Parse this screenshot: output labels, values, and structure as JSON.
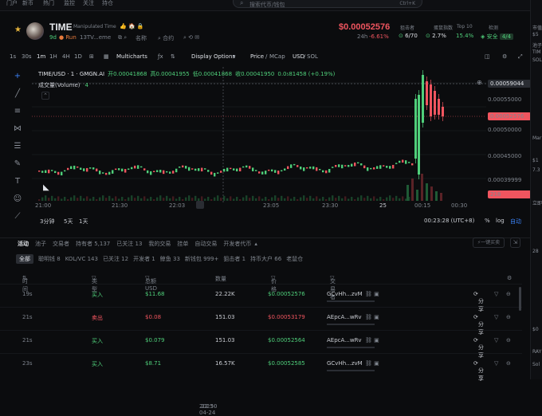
{
  "nav": {
    "items": [
      "门户",
      "新币",
      "热门",
      "监控",
      "关注",
      "持仓"
    ]
  },
  "search": {
    "placeholder": "搜索代币/钱包",
    "shortcut": "Ctrl+K"
  },
  "token": {
    "name": "TIME",
    "fullname": "Manipulated Time",
    "age": "9d",
    "run": "Run",
    "ca": "13TV...eme",
    "name_label": "名称",
    "contract_label": "合约",
    "price": "$0.00052576",
    "change_24h_label": "24h",
    "change_24h": "-6.61%",
    "snipers_label": "狙击者",
    "snipers": "6/70",
    "rat_label": "蛋鼠指数",
    "rat": "2.7%",
    "top10_label": "Top 10",
    "top10": "15.4%",
    "audit_label": "检测",
    "audit_safe": "安全",
    "audit_count": "4/4"
  },
  "toolbar": {
    "intervals": [
      "1s",
      "30s",
      "1m",
      "1H",
      "4H",
      "1D"
    ],
    "multicharts": "Multicharts",
    "display": "Display Options",
    "price": "Price",
    "mcap": "MCap",
    "usd": "USD",
    "sol": "SOL"
  },
  "ohlc": {
    "symbol": "TIME/USD · 1 · GMGN.AI",
    "open_label": "开",
    "open": "0.00041868",
    "high_label": "高",
    "high": "0.00041955",
    "low_label": "低",
    "low": "0.00041868",
    "close_label": "收",
    "close": "0.00041950",
    "delta": "0.0₅81458 (+0.19%)",
    "volume_label": "成交量(Volume)",
    "volume_value": "4"
  },
  "price_axis": [
    "0.00059044",
    "0.00055000",
    "0.00052576",
    "0.00050000",
    "0.00045000",
    "0.00039999"
  ],
  "volume_tag": "218",
  "time_axis": [
    "21:00",
    "21:30",
    "22:03",
    "2025-04-24",
    "22:30",
    "23:05",
    "23:30",
    "25",
    "00:15",
    "00:30"
  ],
  "bottom": {
    "ranges": [
      "3分钟",
      "5天",
      "1天"
    ],
    "clock": "00:23:28 (UTC+8)",
    "pct": "%",
    "log": "log",
    "auto": "自动"
  },
  "tabs": [
    "活动",
    "池子",
    "交易者",
    "持有者 5,137",
    "已关注 13",
    "我的交易",
    "挂单",
    "自动交易",
    "开发者代币"
  ],
  "actions": {
    "one_click": "一键买卖"
  },
  "filters": [
    "全部",
    "聪明钱 8",
    "KOL/VC 143",
    "已关注 12",
    "开发者 1",
    "鲸鱼 33",
    "新钱包 999+",
    "狙击者 1",
    "持币大户 66",
    "老鼠仓"
  ],
  "columns": [
    "时间",
    "类型",
    "总额 USD",
    "数量",
    "价格",
    "交易者"
  ],
  "rows": [
    {
      "time": "19s",
      "type": "买入",
      "side": "buy",
      "total": "$11.68",
      "qty": "22.22K",
      "price": "$0.00052576",
      "trader": "GCvHh...zvM",
      "share": "分享"
    },
    {
      "time": "21s",
      "type": "卖出",
      "side": "sell",
      "total": "$0.08",
      "qty": "151.03",
      "price": "$0.00053179",
      "trader": "AEpcA...wRv",
      "share": "分享"
    },
    {
      "time": "21s",
      "type": "买入",
      "side": "buy",
      "total": "$0.079",
      "qty": "151.03",
      "price": "$0.00052564",
      "trader": "AEpcA...wRv",
      "share": "分享"
    },
    {
      "time": "23s",
      "type": "买入",
      "side": "buy",
      "total": "$8.71",
      "qty": "16.57K",
      "price": "$0.00052585",
      "trader": "GCvHh...zvM",
      "share": "分享"
    }
  ],
  "right": {
    "labels": [
      "市值",
      "$5",
      "池子",
      "TIM",
      "SOL",
      "Mar",
      "$1",
      "7.3",
      "立即",
      "28",
      "$0",
      "RAY",
      "Sol"
    ]
  },
  "colors": {
    "up": "#4fcf7a",
    "down": "#f0555f",
    "bg": "#0b0c0e",
    "accent": "#3dd68c"
  }
}
